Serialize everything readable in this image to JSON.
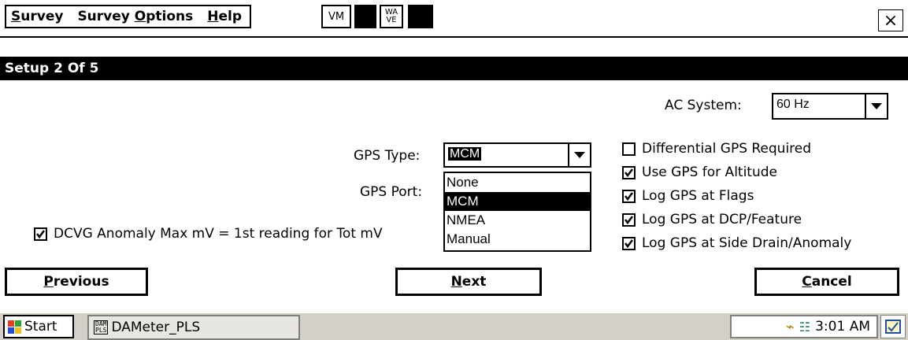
{
  "menu": {
    "items": [
      {
        "label": "Survey"
      },
      {
        "label": "Survey Options"
      },
      {
        "label": "Help"
      }
    ],
    "vm_label": "VM",
    "wave_line1": "WA",
    "wave_line2": "VE",
    "close_glyph": "×"
  },
  "dialog": {
    "title": "Setup 2 Of 5",
    "ac_system": {
      "label": "AC System:",
      "value": "60 Hz"
    },
    "gps_type": {
      "label": "GPS Type:",
      "value": "MCM",
      "options": [
        "None",
        "MCM",
        "NMEA",
        "Manual"
      ],
      "selected_index": 1
    },
    "gps_port": {
      "label": "GPS Port:"
    },
    "dcvg_checkbox": {
      "label": "DCVG Anomaly Max mV = 1st reading for Tot mV",
      "checked": true
    },
    "options": [
      {
        "label": "Differential GPS Required",
        "checked": false
      },
      {
        "label": "Use GPS for Altitude",
        "checked": true
      },
      {
        "label": "Log GPS at Flags",
        "checked": true
      },
      {
        "label": "Log GPS at DCP/Feature",
        "checked": true
      },
      {
        "label": "Log GPS at Side Drain/Anomaly",
        "checked": true
      }
    ],
    "buttons": {
      "previous": "Previous",
      "next": "Next",
      "cancel": "Cancel"
    }
  },
  "taskbar": {
    "start_label": "Start",
    "task_label": "DAMeter_PLS",
    "task_icon_text": "DAM PLS",
    "clock": "3:01 AM"
  },
  "colors": {
    "background": "#ffffff",
    "title_bar": "#000000",
    "taskbar": "#d4d0c8"
  }
}
